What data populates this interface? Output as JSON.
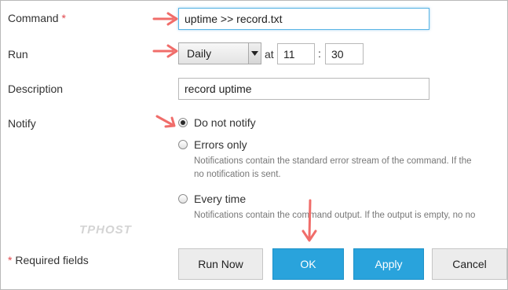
{
  "form": {
    "command": {
      "label": "Command",
      "required_mark": "*",
      "value": "uptime >> record.txt"
    },
    "run": {
      "label": "Run",
      "frequency": "Daily",
      "at_label": "at",
      "hour": "11",
      "separator": ":",
      "minute": "30"
    },
    "description": {
      "label": "Description",
      "value": "record uptime"
    },
    "notify": {
      "label": "Notify",
      "options": [
        {
          "label": "Do not notify",
          "selected": true,
          "hint": []
        },
        {
          "label": "Errors only",
          "selected": false,
          "hint": [
            "Notifications contain the standard error stream of the command. If the",
            "no notification is sent."
          ]
        },
        {
          "label": "Every time",
          "selected": false,
          "hint": [
            "Notifications contain the command output. If the output is empty, no no"
          ]
        }
      ]
    },
    "required_note": "* Required fields"
  },
  "watermark": "TPHOST",
  "buttons": {
    "run_now": "Run Now",
    "ok": "OK",
    "apply": "Apply",
    "cancel": "Cancel"
  },
  "colors": {
    "primary": "#29a3dc",
    "required": "#e0474c",
    "annotation_arrow": "#f06d6a"
  }
}
